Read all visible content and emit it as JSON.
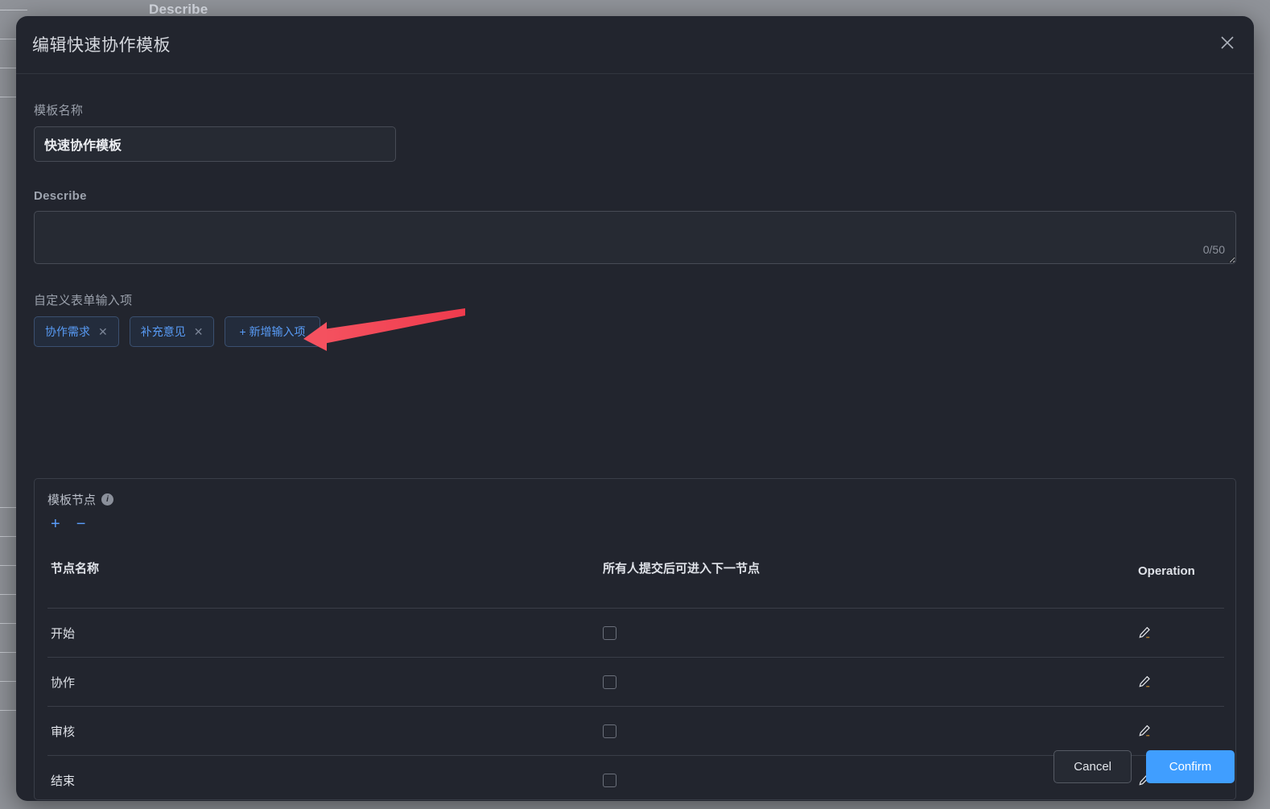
{
  "backdrop": {
    "partial_label": "Describe",
    "row_line_positions": [
      12,
      48,
      84,
      120,
      630,
      666,
      702,
      738,
      774,
      810,
      846,
      882
    ]
  },
  "modal": {
    "title": "编辑快速协作模板",
    "close_icon": "close-icon"
  },
  "form": {
    "name_label": "模板名称",
    "name_value": "快速协作模板",
    "name_placeholder": "",
    "describe_label": "Describe",
    "describe_value": "",
    "describe_placeholder": "",
    "describe_counter": "0/50",
    "custom_items_label": "自定义表单输入项",
    "chips": [
      {
        "label": "协作需求",
        "remove_icon": "close-icon"
      },
      {
        "label": "补充意见",
        "remove_icon": "close-icon"
      }
    ],
    "add_chip_label": "+ 新增输入项"
  },
  "node_panel": {
    "title": "模板节点",
    "info_icon": "info-icon",
    "info_glyph": "i",
    "add_icon": "plus-icon",
    "add_glyph": "+",
    "remove_icon": "minus-icon",
    "remove_glyph": "−",
    "columns": [
      "节点名称",
      "所有人提交后可进入下一节点",
      "Operation"
    ],
    "rows": [
      {
        "name": "开始",
        "checked": false,
        "action_icon": "edit-pencil-icon"
      },
      {
        "name": "协作",
        "checked": false,
        "action_icon": "edit-pencil-icon"
      },
      {
        "name": "审核",
        "checked": false,
        "action_icon": "edit-pencil-icon"
      },
      {
        "name": "结束",
        "checked": false,
        "action_icon": "edit-pencil-icon"
      }
    ]
  },
  "footer": {
    "cancel_label": "Cancel",
    "confirm_label": "Confirm"
  },
  "annotation": {
    "type": "arrow",
    "color": "#f04050",
    "points_to": "add-input-item-button"
  },
  "colors": {
    "accent": "#409eff",
    "link": "#589bf5",
    "modal_bg": "#22252e",
    "backdrop": "#909399",
    "annotation_red": "#f04050"
  }
}
